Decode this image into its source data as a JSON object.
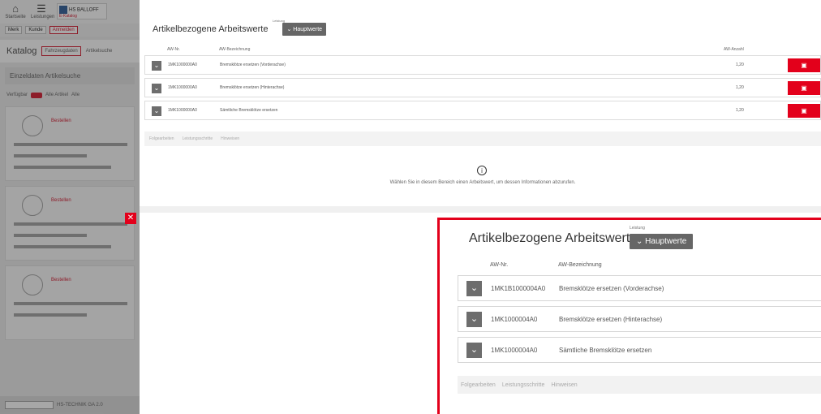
{
  "left_app": {
    "toolbar_icons": [
      {
        "icon": "home-icon",
        "label": "Startseite"
      },
      {
        "icon": "list-icon",
        "label": "Leistungen"
      }
    ],
    "brand": {
      "name": "HS BALLOFF",
      "sub": "E-Katalog"
    },
    "toolbar2": [
      "Merk",
      "Kunde",
      "Anmelden"
    ],
    "katalog_title": "Katalog",
    "katalog_tabs": [
      "Fahrzeugdaten",
      "Artikelsuche"
    ],
    "einzel_title": "Einzeldaten Artikelsuche",
    "filter_labels": [
      "Verfügbar",
      "Alle Artikel",
      "Alle"
    ],
    "cards": [
      {
        "best": "Bestellen"
      },
      {
        "best": "Bestellen"
      },
      {
        "best": "Bestellen"
      }
    ],
    "bottom_text": "HS-TECHNIK GA 2.0"
  },
  "panel": {
    "title": "Artikelbezogene Arbeitswerte",
    "filter_label": "Leistung",
    "filter_button": "Hauptwerte",
    "columns": {
      "nr": "AW-Nr.",
      "desc": "AW-Bezeichnung",
      "qty": "AW-Anzahl"
    },
    "rows": [
      {
        "nr": "1MK1000000A0",
        "desc": "Bremsklötze ersetzen (Vorderachse)",
        "qty": "1,20"
      },
      {
        "nr": "1MK1000000A0",
        "desc": "Bremsklötze ersetzen (Hinterachse)",
        "qty": "1,20"
      },
      {
        "nr": "1MK1000000A0",
        "desc": "Sämtliche Bremsklötze ersetzen",
        "qty": "1,20"
      }
    ],
    "tabs": [
      "Folgearbeiten",
      "Leistungsschritte",
      "Hinweisen"
    ],
    "info_text": "Wählen Sie in diesem Bereich einen Arbeitswert, um dessen Informationen abzurufen."
  },
  "zoom": {
    "title": "Artikelbezogene Arbeitswerte",
    "filter_label": "Leistung",
    "filter_button": "Hauptwerte",
    "columns": {
      "nr": "AW-Nr.",
      "desc": "AW-Bezeichnung"
    },
    "rows": [
      {
        "nr": "1MK1B1000004A0",
        "desc": "Bremsklötze ersetzen (Vorderachse)"
      },
      {
        "nr": "1MK1000004A0",
        "desc": "Bremsklötze ersetzen (Hinterachse)"
      },
      {
        "nr": "1MK1000004A0",
        "desc": "Sämtliche Bremsklötze ersetzen"
      }
    ],
    "tabs": [
      "Folgearbeiten",
      "Leistungsschritte",
      "Hinweisen"
    ]
  },
  "colors": {
    "accent": "#e3001b",
    "button_grey": "#666666"
  }
}
